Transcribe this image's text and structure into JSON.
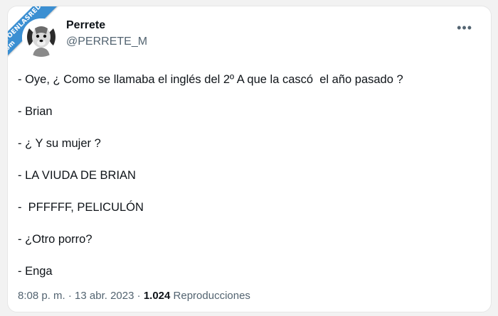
{
  "watermark": "VISTOENLASREDES .com",
  "author": {
    "name": "Perrete",
    "handle": "@PERRETE_M"
  },
  "more_icon": "more-horizontal-icon",
  "tweet_lines": [
    "- Oye, ¿ Como se llamaba el inglés del 2º A que la cascó  el año pasado ?",
    "- Brian",
    "- ¿ Y su mujer ?",
    "- LA VIUDA DE BRIAN",
    "-  PFFFFF, PELICULÓN",
    "- ¿Otro porro?",
    "- Enga"
  ],
  "meta": {
    "time": "8:08 p. m.",
    "sep1": " · ",
    "date": "13 abr. 2023",
    "sep2": " · ",
    "views": "1.024",
    "views_label": " Reproducciones"
  },
  "colors": {
    "text": "#0f1419",
    "secondary": "#536471",
    "watermark": "#3b8fd2"
  }
}
